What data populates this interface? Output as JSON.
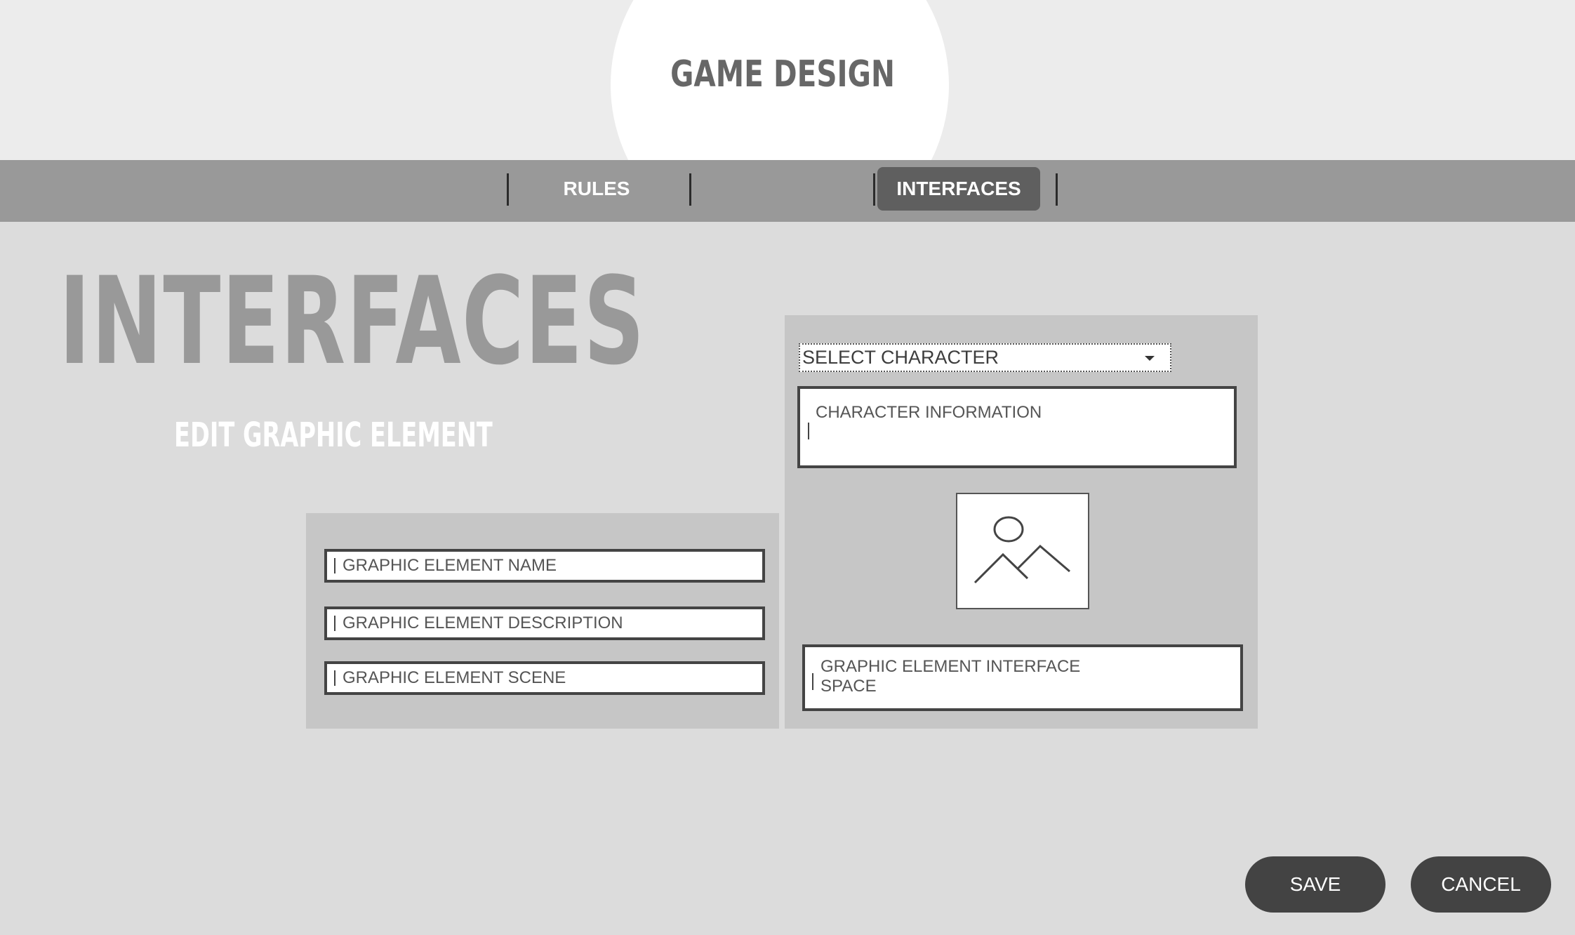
{
  "header": {
    "app_title": "GAME DESIGN"
  },
  "nav": {
    "tabs": [
      {
        "label": "RULES",
        "active": false
      },
      {
        "label": "",
        "active": false
      },
      {
        "label": "INTERFACES",
        "active": true
      }
    ]
  },
  "main": {
    "page_heading": "INTERFACES",
    "section_heading": "EDIT GRAPHIC ELEMENT"
  },
  "left_panel": {
    "fields": [
      {
        "placeholder": "GRAPHIC ELEMENT NAME"
      },
      {
        "placeholder": "GRAPHIC ELEMENT DESCRIPTION"
      },
      {
        "placeholder": "GRAPHIC ELEMENT SCENE"
      }
    ]
  },
  "right_panel": {
    "select_character": "SELECT CHARACTER",
    "character_info_placeholder": "CHARACTER INFORMATION",
    "image_icon": "image-placeholder-icon",
    "interface_space_line1": "GRAPHIC ELEMENT INTERFACE",
    "interface_space_line2": "SPACE"
  },
  "actions": {
    "save_label": "SAVE",
    "cancel_label": "CANCEL"
  },
  "colors": {
    "header_bg": "#ececec",
    "nav_bg": "#999999",
    "active_tab_bg": "#5f5f5f",
    "page_bg": "#dcdcdc",
    "panel_bg": "#c6c6c6",
    "button_bg": "#434343"
  }
}
